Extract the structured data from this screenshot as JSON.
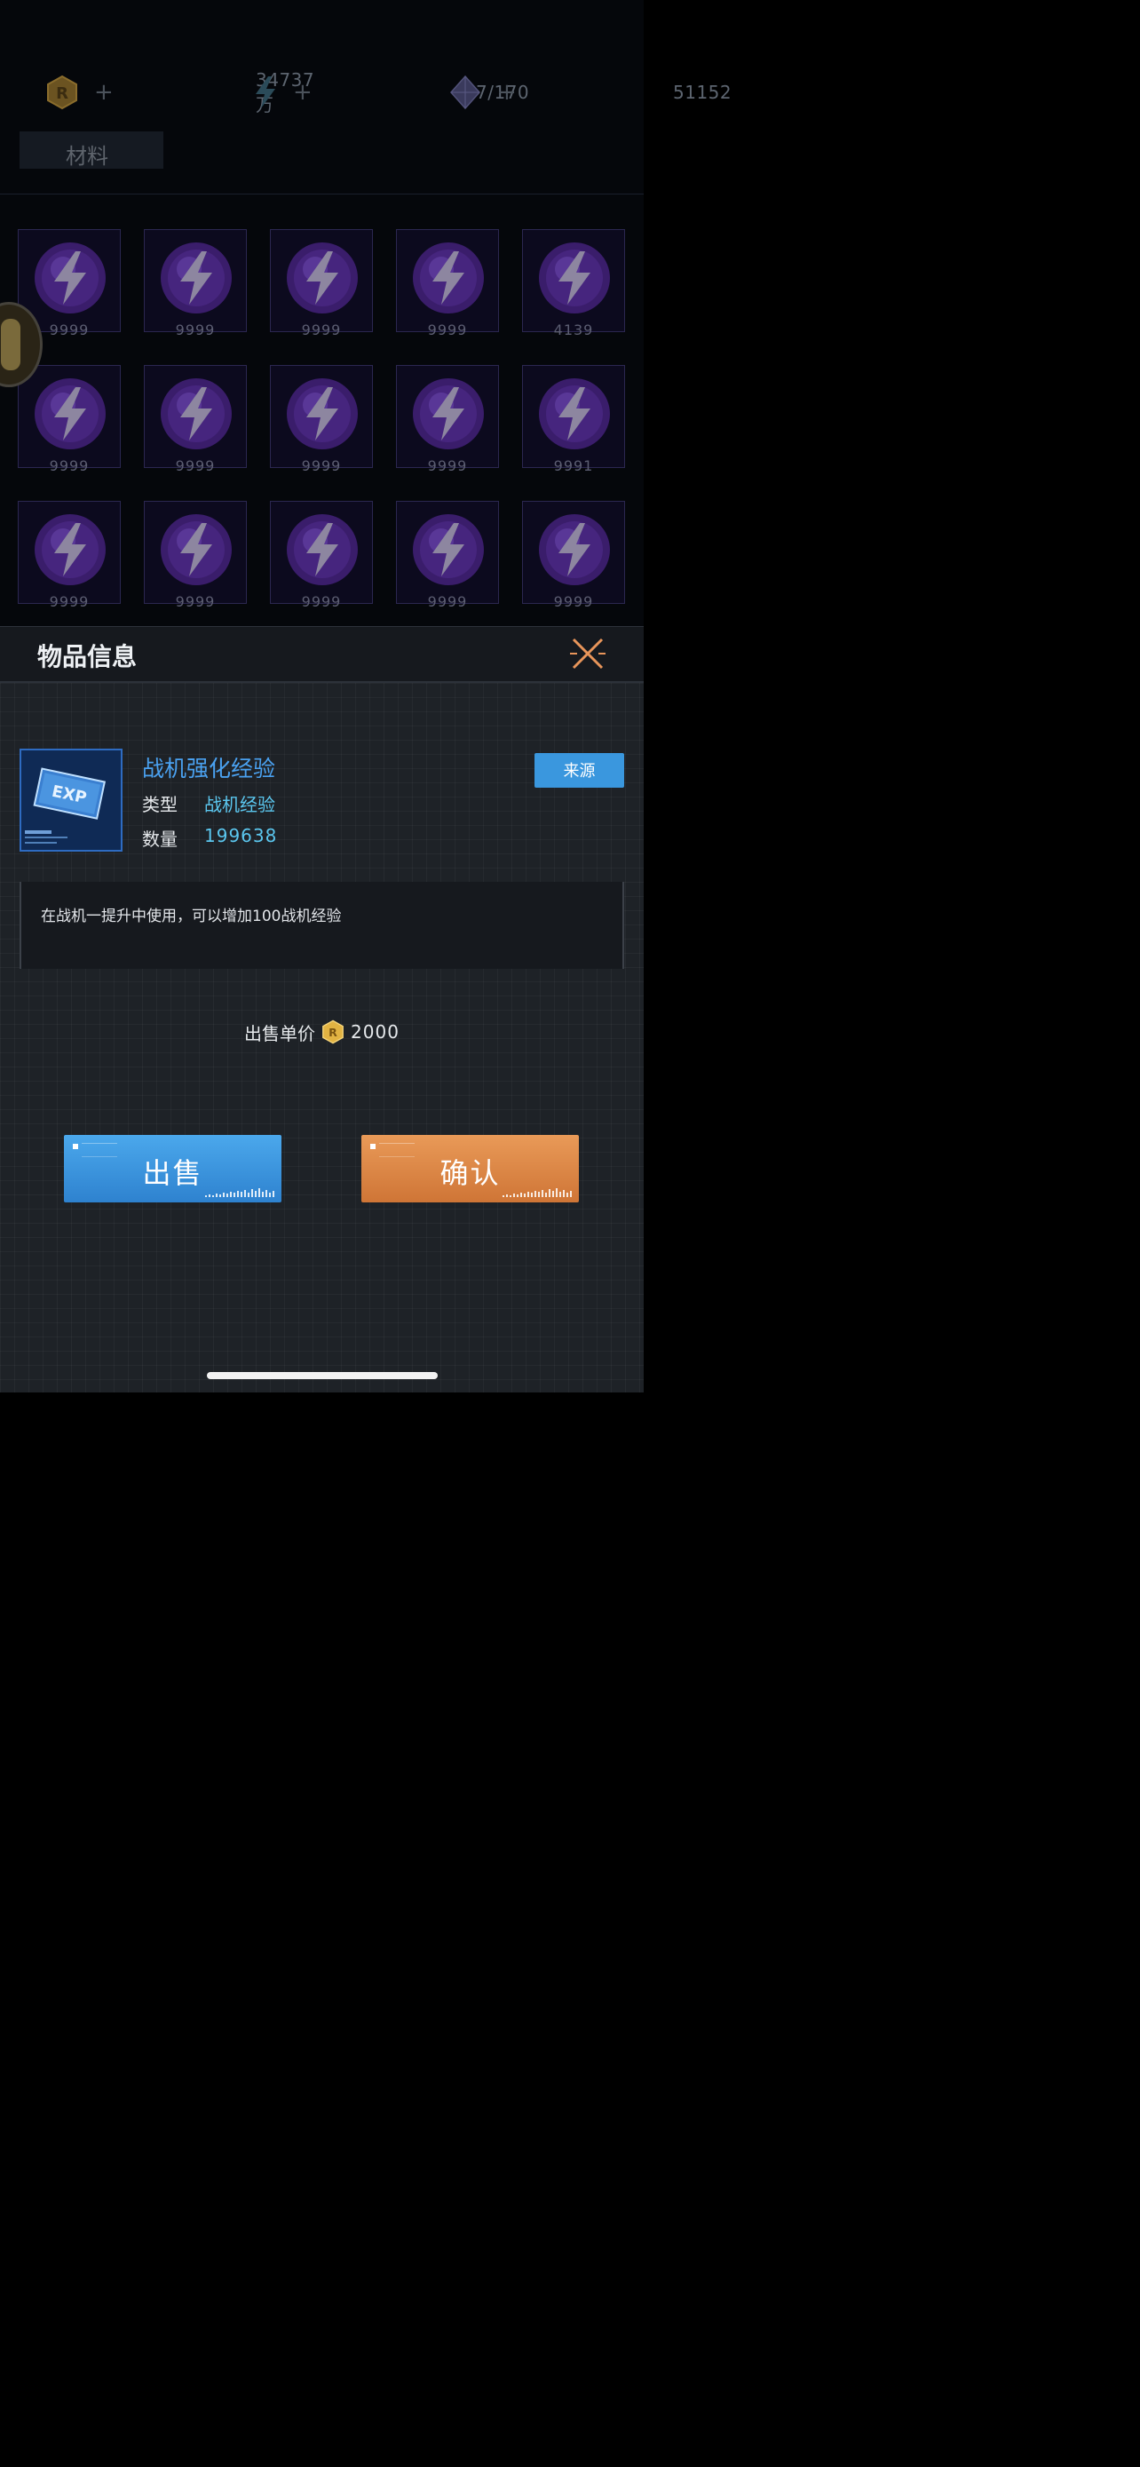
{
  "resources": {
    "gold": {
      "value": "34737万",
      "icon": "gold-coin-icon"
    },
    "energy": {
      "value": "7/170",
      "icon": "lightning-icon"
    },
    "crystal": {
      "value": "51152",
      "icon": "crystal-icon"
    },
    "plus": "+"
  },
  "tab": {
    "label": "材料"
  },
  "items": [
    "9999",
    "9999",
    "9999",
    "9999",
    "4139",
    "9999",
    "9999",
    "9999",
    "9999",
    "9991",
    "9999",
    "9999",
    "9999",
    "9999",
    "9999"
  ],
  "dialog": {
    "title": "物品信息",
    "item_name": "战机强化经验",
    "type_label": "类型",
    "type_value": "战机经验",
    "qty_label": "数量",
    "qty_value": "199638",
    "source_button": "来源",
    "description": "在战机一提升中使用，可以增加100战机经验",
    "price_label": "出售单价",
    "price_value": "2000",
    "sell_button": "出售",
    "confirm_button": "确认",
    "thumb_text": "EXP"
  },
  "colors": {
    "item_name": "#4aa1f0",
    "value_cyan": "#5bc7ef",
    "sell": "#3a97de",
    "confirm": "#e08a48"
  }
}
